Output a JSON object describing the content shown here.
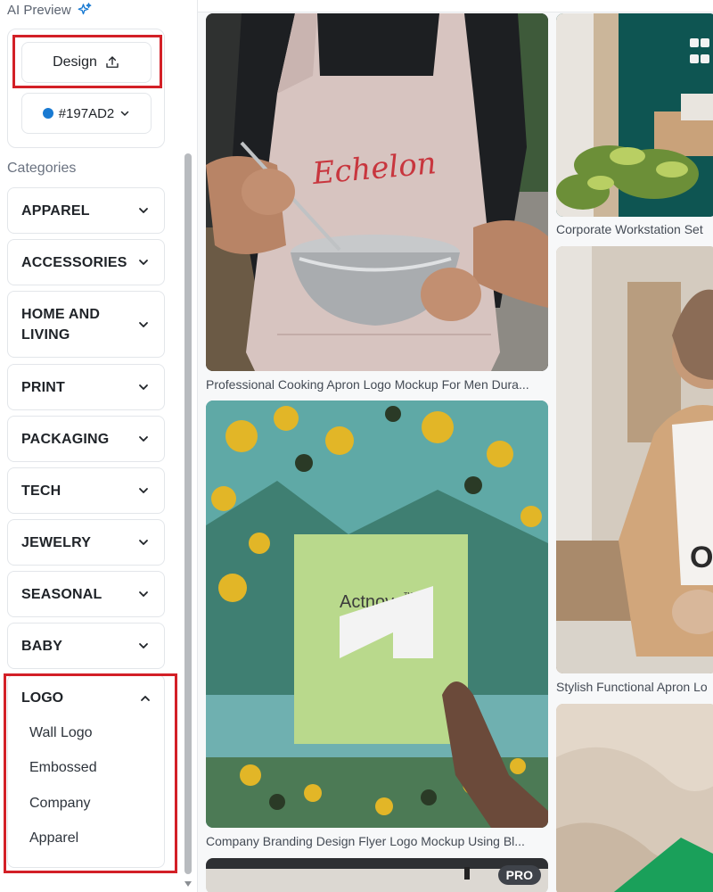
{
  "sidebar": {
    "ai_preview_label": "AI Preview",
    "design_button_label": "Design",
    "color_value": "#197AD2",
    "categories_heading": "Categories",
    "categories": [
      {
        "label": "APPAREL"
      },
      {
        "label": "ACCESSORIES"
      },
      {
        "label": "HOME AND LIVING"
      },
      {
        "label": "PRINT"
      },
      {
        "label": "PACKAGING"
      },
      {
        "label": "TECH"
      },
      {
        "label": "JEWELRY"
      },
      {
        "label": "SEASONAL"
      },
      {
        "label": "BABY"
      }
    ],
    "expanded_category": {
      "label": "LOGO",
      "items": [
        "Wall Logo",
        "Embossed",
        "Company",
        "Apparel"
      ]
    }
  },
  "gallery": {
    "cards": [
      {
        "caption": "Professional Cooking Apron Logo Mockup For Men Dura...",
        "print_text": "Echelon"
      },
      {
        "caption": "Company Branding Design Flyer Logo Mockup Using Bl...",
        "print_text": "Actnova",
        "trademark": "TM"
      },
      {
        "caption": "Corporate Workstation Set"
      },
      {
        "caption": "Stylish Functional Apron Lo"
      },
      {
        "badge": "PRO"
      }
    ]
  },
  "colors": {
    "accent": "#197AD2",
    "highlight_border": "#d32027"
  },
  "icons": {
    "ai_preview": "sparkle-icon",
    "design": "upload-icon",
    "dropdown": "chevron-down-icon",
    "collapse": "chevron-up-icon"
  }
}
